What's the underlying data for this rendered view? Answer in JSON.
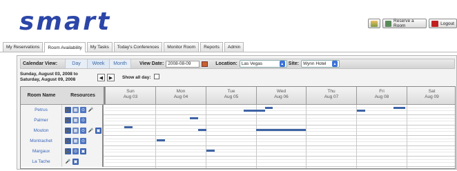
{
  "logo": "smart",
  "header": {
    "reserve_label": "Reserve a Room",
    "logout_label": "Logout"
  },
  "tabs": [
    "My Reservations",
    "Room Availability",
    "My Tasks",
    "Today's Conferences",
    "Monitor Room",
    "Reports",
    "Admin"
  ],
  "toolbar": {
    "calendar_view_label": "Calendar View:",
    "views": [
      "Day",
      "Week",
      "Month"
    ],
    "view_date_label": "View Date:",
    "view_date": "2008-08-09",
    "location_label": "Location:",
    "location": "Las Vegas",
    "site_label": "Site:",
    "site": "Wynn Hotel"
  },
  "range": {
    "line1": "Sunday, August 03, 2008 to",
    "line2": "Saturday, August 09, 2008",
    "show_all_day": "Show all day:"
  },
  "grid": {
    "room_header": "Room Name",
    "resources_header": "Resources",
    "days": [
      {
        "d": "Sun",
        "dt": "Aug 03"
      },
      {
        "d": "Mon",
        "dt": "Aug 04"
      },
      {
        "d": "Tue",
        "dt": "Aug 05"
      },
      {
        "d": "Wed",
        "dt": "Aug 06"
      },
      {
        "d": "Thu",
        "dt": "Aug 07"
      },
      {
        "d": "Fri",
        "dt": "Aug 08"
      },
      {
        "d": "Sat",
        "dt": "Aug 09"
      }
    ],
    "rooms": [
      "Petrus",
      "Palmer",
      "Mouton",
      "Montrachet",
      "Margaux",
      "La Tache"
    ]
  },
  "colors": {
    "accent": "#2c46a8",
    "bar": "#3d63a5"
  }
}
